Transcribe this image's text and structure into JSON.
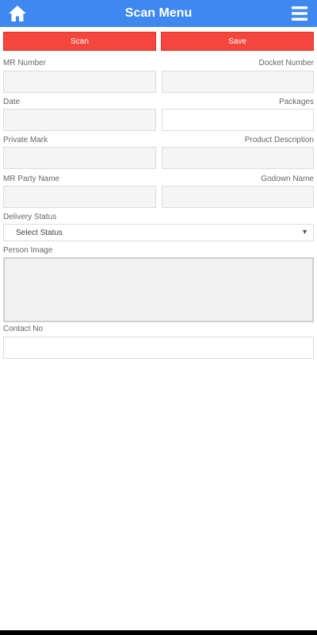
{
  "header": {
    "title": "Scan Menu",
    "color": "#3f88f0"
  },
  "icons": {
    "home": "home-icon",
    "menu": "hamburger-menu-icon"
  },
  "actions": {
    "scan_label": "Scan",
    "save_label": "Save",
    "button_color": "#f3473d"
  },
  "form": {
    "mr_number_label": "MR Number",
    "mr_number_value": "",
    "docket_number_label": "Docket Number",
    "docket_number_value": "",
    "date_label": "Date",
    "date_value": "",
    "packages_label": "Packages",
    "packages_value": "",
    "private_mark_label": "Private Mark",
    "private_mark_value": "",
    "product_description_label": "Product Description",
    "product_description_value": "",
    "mr_party_name_label": "MR Party Name",
    "mr_party_name_value": "",
    "godown_name_label": "Godown Name",
    "godown_name_value": "",
    "delivery_status_label": "Delivery Status",
    "delivery_status_selected": "Select Status",
    "person_image_label": "Person Image",
    "contact_no_label": "Contact No",
    "contact_no_value": ""
  }
}
